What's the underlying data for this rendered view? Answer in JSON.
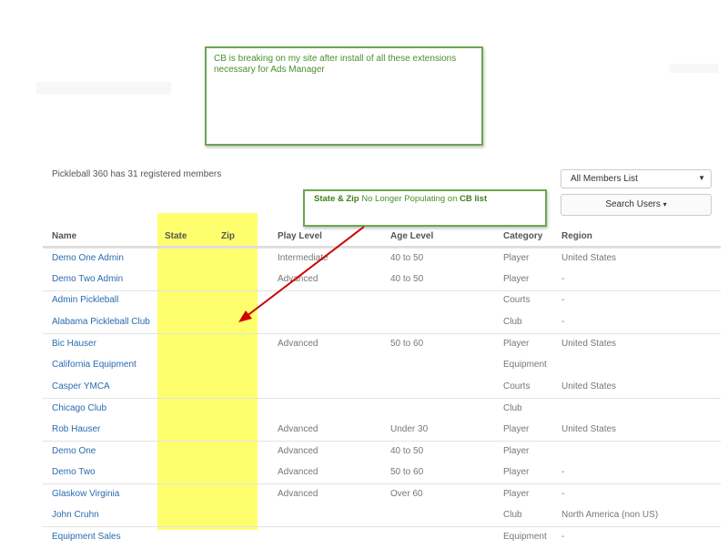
{
  "annotation_top": "CB is breaking on my site after install of all these extensions necessary for Ads Manager",
  "annotation_list": {
    "bold1": "State & Zip",
    "text1": " No Longer Populating on ",
    "bold2": "CB list"
  },
  "members_count": "Pickleball 360 has 31 registered members",
  "list_select": "All Members List",
  "search_button": "Search Users",
  "columns": [
    "Name",
    "State",
    "Zip",
    "Play Level",
    "Age Level",
    "Category",
    "Region"
  ],
  "rows": [
    {
      "name": "Demo One Admin",
      "play": "Intermediate",
      "age": "40 to 50",
      "category": "Player",
      "region": "United States"
    },
    {
      "name": "Demo Two Admin",
      "play": "Advanced",
      "age": "40 to 50",
      "category": "Player",
      "region": "-"
    },
    {
      "name": "Admin Pickleball",
      "play": "",
      "age": "",
      "category": "Courts",
      "region": "-"
    },
    {
      "name": "Alabama Pickleball Club",
      "play": "",
      "age": "",
      "category": "Club",
      "region": "-"
    },
    {
      "name": "Bic Hauser",
      "play": "Advanced",
      "age": "50 to 60",
      "category": "Player",
      "region": "United States"
    },
    {
      "name": "California Equipment",
      "play": "",
      "age": "",
      "category": "Equipment",
      "region": ""
    },
    {
      "name": "Casper YMCA",
      "play": "",
      "age": "",
      "category": "Courts",
      "region": "United States"
    },
    {
      "name": "Chicago Club",
      "play": "",
      "age": "",
      "category": "Club",
      "region": ""
    },
    {
      "name": "Rob Hauser",
      "play": "Advanced",
      "age": "Under 30",
      "category": "Player",
      "region": "United States"
    },
    {
      "name": "Demo One",
      "play": "Advanced",
      "age": "40 to 50",
      "category": "Player",
      "region": ""
    },
    {
      "name": "Demo Two",
      "play": "Advanced",
      "age": "50 to 60",
      "category": "Player",
      "region": "-"
    },
    {
      "name": "Glaskow Virginia",
      "play": "Advanced",
      "age": "Over 60",
      "category": "Player",
      "region": "-"
    },
    {
      "name": "John Cruhn",
      "play": "",
      "age": "",
      "category": "Club",
      "region": "North America (non US)"
    },
    {
      "name": "Equipment Sales",
      "play": "",
      "age": "",
      "category": "Equipment",
      "region": "-"
    }
  ],
  "colors": {
    "highlight": "#ffff55",
    "annotation_border": "#6aa84f",
    "arrow": "#cc0000",
    "link": "#2a6bb0"
  }
}
